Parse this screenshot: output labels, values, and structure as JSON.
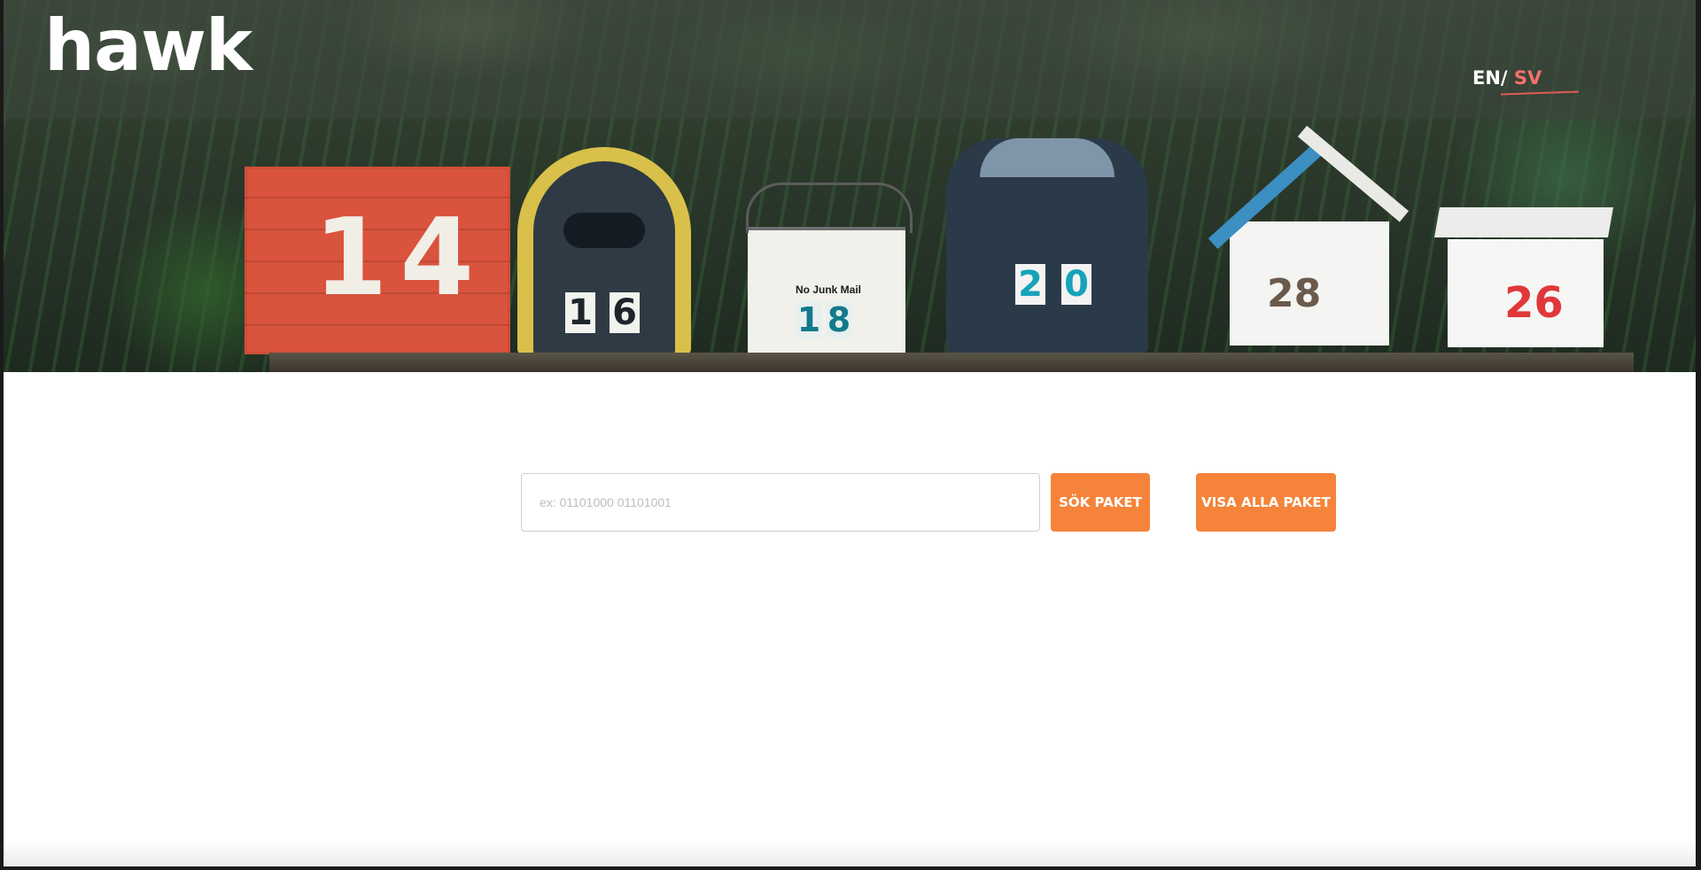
{
  "header": {
    "logo": "hawk",
    "lang_en": "EN",
    "lang_sep": "/",
    "lang_sv": "SV"
  },
  "hero": {
    "mailboxes": [
      {
        "number": "14"
      },
      {
        "number_left": "1",
        "number_right": "6"
      },
      {
        "sign": "No Junk Mail",
        "number_left": "1",
        "number_right": "8"
      },
      {
        "number_left": "2",
        "number_right": "0"
      },
      {
        "number": "28"
      },
      {
        "number": "26"
      }
    ]
  },
  "search": {
    "placeholder": "ex: 01101000 01101001",
    "value": "",
    "search_button": "SÖK PAKET",
    "show_all_button": "VISA ALLA PAKET"
  },
  "colors": {
    "accent": "#f5843a",
    "lang_active": "#f3716a"
  }
}
